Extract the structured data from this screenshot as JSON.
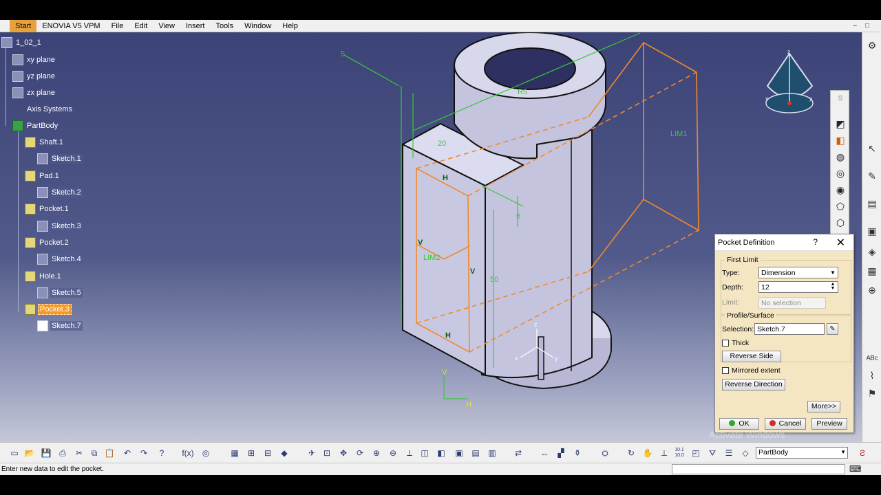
{
  "menu": {
    "items": [
      "Start",
      "ENOVIA V5 VPM",
      "File",
      "Edit",
      "View",
      "Insert",
      "Tools",
      "Window",
      "Help"
    ],
    "window_controls": [
      "–",
      "□"
    ]
  },
  "tree": {
    "root": "1_02_1",
    "planes": [
      "xy plane",
      "yz plane",
      "zx plane"
    ],
    "axis": "Axis Systems",
    "body": "PartBody",
    "features": [
      {
        "label": "Shaft.1",
        "sketch": "Sketch.1"
      },
      {
        "label": "Pad.1",
        "sketch": "Sketch.2"
      },
      {
        "label": "Pocket.1",
        "sketch": "Sketch.3"
      },
      {
        "label": "Pocket.2",
        "sketch": "Sketch.4"
      },
      {
        "label": "Hole.1",
        "sketch": "Sketch.5"
      },
      {
        "label": "Pocket.3",
        "sketch": "Sketch.7"
      }
    ]
  },
  "viewport": {
    "annotations": {
      "dim_5": "5",
      "dim_20": "20",
      "dim_r": "R5",
      "lim1": "LIM1",
      "lim2": "LIM2",
      "h_top": "H",
      "h_bottom": "H",
      "v_left": "V",
      "v_right": "V",
      "dim_50": "50",
      "dim_6": "6"
    },
    "axis_labels": {
      "x": "x",
      "y": "y",
      "z": "z",
      "h": "H",
      "v": "V"
    },
    "compass_labels": {
      "z": "z",
      "x": "x",
      "y": "y"
    }
  },
  "sketch_toolbar": {
    "header": "S"
  },
  "dialog": {
    "title": "Pocket Definition",
    "help": "?",
    "close": "✕",
    "first_limit": {
      "group_label": "First Limit",
      "type_label": "Type:",
      "type_value": "Dimension",
      "depth_label": "Depth:",
      "depth_value": "12",
      "limit_label": "Limit:",
      "limit_value": "No selection"
    },
    "profile": {
      "group_label": "Profile/Surface",
      "selection_label": "Selection:",
      "selection_value": "Sketch.7",
      "thick_label": "Thick",
      "reverse_side": "Reverse Side"
    },
    "mirrored_label": "Mirrored extent",
    "reverse_direction": "Reverse Direction",
    "more": "More>>",
    "ok": "OK",
    "cancel": "Cancel",
    "preview": "Preview",
    "colors": {
      "ok": "#2ea82e",
      "cancel": "#d52a2a"
    }
  },
  "bottom_toolbar": {
    "body_select": "PartBody",
    "text_icons": {
      "num": "10.1\n10.0"
    }
  },
  "status": {
    "text": "Enter new data to edit the pocket."
  },
  "watermark": "Activate Windows"
}
